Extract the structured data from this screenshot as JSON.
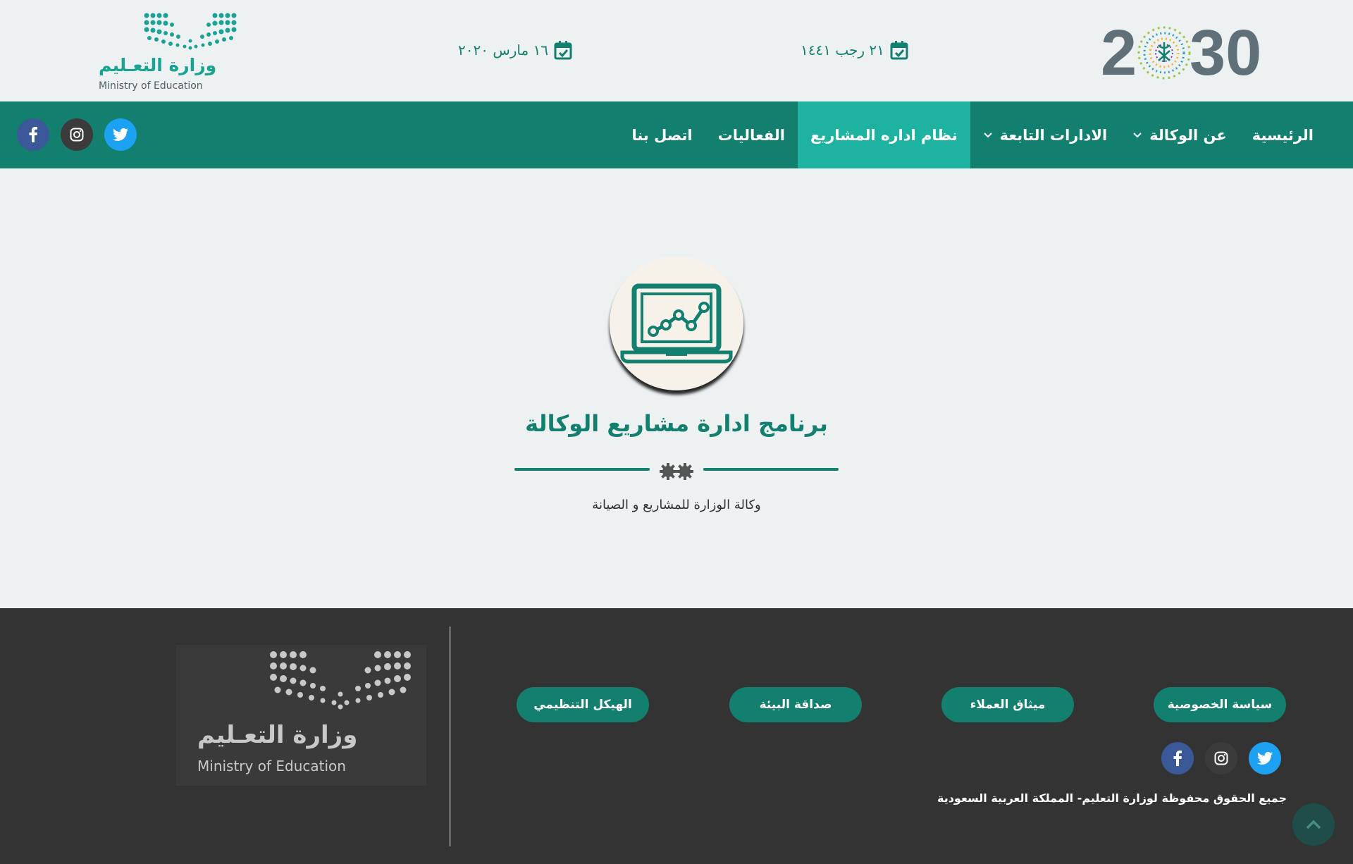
{
  "header": {
    "vision_logo": {
      "icon": "vision-2030-logo",
      "text_left": "2",
      "text_right": "30"
    },
    "hijri_date": {
      "icon": "calendar-check-icon",
      "text": "٢١ رجب ١٤٤١"
    },
    "gregorian_date": {
      "icon": "calendar-check-icon",
      "text": "١٦ مارس ٢٠٢٠"
    },
    "moe_logo": {
      "icon": "ministry-of-education-logo",
      "arabic": "وزارة التعـليم",
      "english": "Ministry of Education"
    }
  },
  "nav": {
    "items": [
      {
        "label": "الرئيسية",
        "dropdown": false,
        "active": false
      },
      {
        "label": "عن الوكالة",
        "dropdown": true,
        "active": false
      },
      {
        "label": "الادارات التابعة",
        "dropdown": true,
        "active": false
      },
      {
        "label": "نظام اداره المشاريع",
        "dropdown": false,
        "active": true
      },
      {
        "label": "الفعاليات",
        "dropdown": false,
        "active": false
      },
      {
        "label": "اتصل بنا",
        "dropdown": false,
        "active": false
      }
    ],
    "socials": [
      "twitter-icon",
      "instagram-icon",
      "facebook-icon"
    ]
  },
  "hero": {
    "icon": "laptop-chart-icon",
    "title": "برنامج ادارة مشاريع الوكالة",
    "divider_icon": "gears-icon",
    "subtitle": "وكالة الوزارة للمشاريع و الصيانة"
  },
  "footer": {
    "links": [
      "سياسة الخصوصية",
      "ميثاق العملاء",
      "صداقة البيئة",
      "الهيكل التنظيمي"
    ],
    "copyright": "جميع الحقوق محفوظة لوزارة التعليم- المملكة العربية السعودية",
    "moe_logo": {
      "arabic": "وزارة التعـليم",
      "english": "Ministry of Education"
    },
    "back_to_top_icon": "chevron-up-icon"
  },
  "colors": {
    "primary": "#127f6f",
    "active_nav": "#1db3a0",
    "footer_bg": "#333333",
    "page_bg": "#eef1f2"
  }
}
